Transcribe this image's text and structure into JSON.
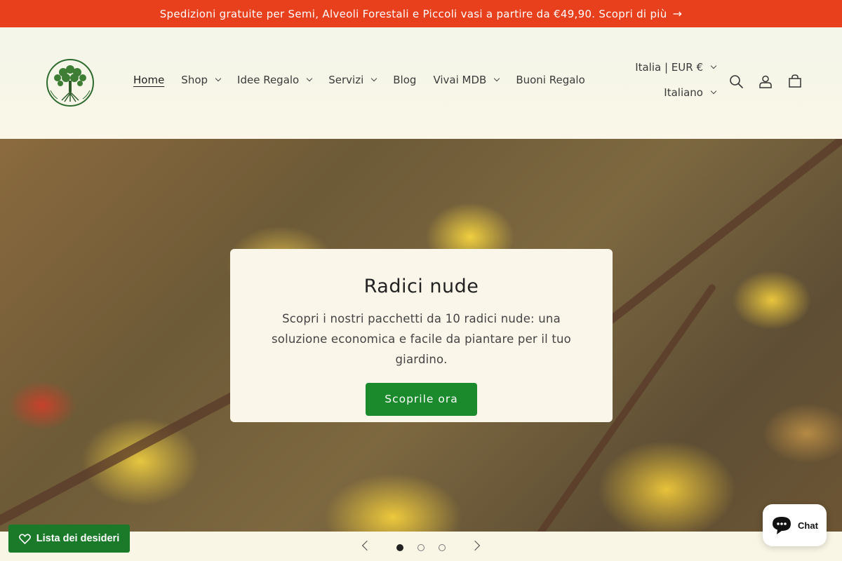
{
  "announcement": {
    "text": "Spedizioni gratuite per Semi, Alveoli Forestali e Piccoli vasi a partire da €49,90. Scopri di più",
    "arrow": "→"
  },
  "header": {
    "nav": [
      {
        "label": "Home",
        "active": true,
        "dropdown": false
      },
      {
        "label": "Shop",
        "dropdown": true
      },
      {
        "label": "Idee Regalo",
        "dropdown": true
      },
      {
        "label": "Servizi",
        "dropdown": true
      },
      {
        "label": "Blog",
        "dropdown": false
      },
      {
        "label": "Vivai MDB",
        "dropdown": true
      },
      {
        "label": "Buoni Regalo",
        "dropdown": false
      }
    ],
    "country": "Italia | EUR €",
    "language": "Italiano",
    "icons": [
      "search-icon",
      "account-icon",
      "cart-icon"
    ]
  },
  "hero": {
    "title": "Radici nude",
    "text": "Scopri i nostri pacchetti da 10 radici nude: una soluzione economica e facile da piantare per il tuo giardino.",
    "cta": "Scoprile ora",
    "slides": 3,
    "current_slide": 1
  },
  "wishlist": {
    "label": "Lista dei desideri"
  },
  "chat": {
    "label": "Chat"
  },
  "colors": {
    "announcement_bg": "#e8401c",
    "accent_green": "#1b8a2c",
    "page_bg": "#faf6e6"
  }
}
